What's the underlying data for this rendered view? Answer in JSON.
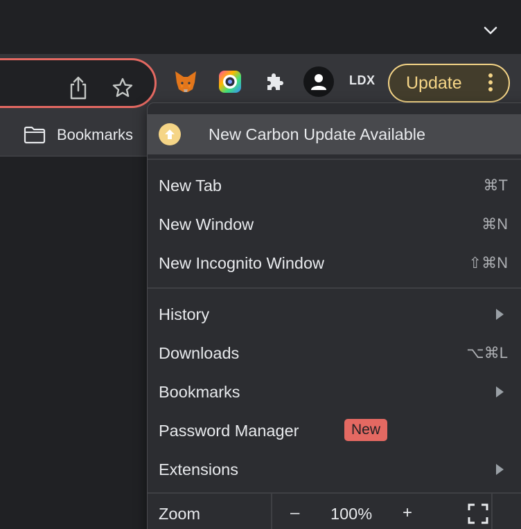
{
  "toolbar": {
    "ldx_label": "LDX",
    "update_label": "Update"
  },
  "bookmarks_bar": {
    "folder_label": "Bookmarks"
  },
  "menu": {
    "update_banner": "New Carbon Update Available",
    "items": [
      {
        "label": "New Tab",
        "shortcut": "⌘T"
      },
      {
        "label": "New Window",
        "shortcut": "⌘N"
      },
      {
        "label": "New Incognito Window",
        "shortcut": "⇧⌘N"
      },
      {
        "label": "History",
        "shortcut": ""
      },
      {
        "label": "Downloads",
        "shortcut": "⌥⌘L"
      },
      {
        "label": "Bookmarks",
        "shortcut": ""
      },
      {
        "label": "Password Manager",
        "badge": "New"
      },
      {
        "label": "Extensions",
        "shortcut": ""
      }
    ],
    "zoom": {
      "label": "Zoom",
      "minus": "–",
      "value": "100%",
      "plus": "+"
    }
  },
  "colors": {
    "accent_update": "#f5d587",
    "omnibox_border": "#e46962",
    "badge_new": "#e46962",
    "menu_bg": "#2c2d31",
    "toolbar_bg": "#35363a"
  }
}
